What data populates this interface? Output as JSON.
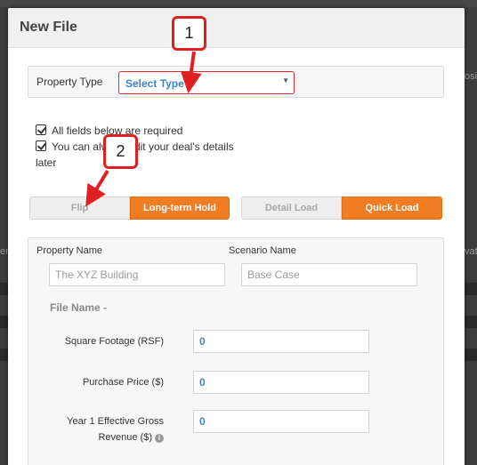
{
  "background": {
    "edge_text_right_1": "osit",
    "edge_text_left": "er",
    "edge_text_right_2": "vat"
  },
  "modal": {
    "title": "New File",
    "property_type": {
      "label": "Property Type",
      "selected": "Select Type"
    },
    "notes": [
      "All fields below are required",
      "You can always edit your deal's details",
      "later"
    ],
    "strategy_toggle": {
      "options": [
        "Flip",
        "Long-term Hold"
      ],
      "active": "Long-term Hold"
    },
    "load_toggle": {
      "options": [
        "Detail Load",
        "Quick Load"
      ],
      "active": "Quick Load"
    },
    "form": {
      "property_name_label": "Property Name",
      "property_name_placeholder": "The XYZ Building",
      "scenario_name_label": "Scenario Name",
      "scenario_name_placeholder": "Base Case",
      "file_name": "File Name -",
      "fields": [
        {
          "label": "Square Footage (RSF)",
          "value": "0"
        },
        {
          "label": "Purchase Price ($)",
          "value": "0"
        },
        {
          "label_line1": "Year 1 Effective Gross",
          "label_line2": "Revenue ($)",
          "value": "0"
        }
      ]
    }
  },
  "callouts": [
    "1",
    "2"
  ],
  "colors": {
    "accent_orange": "#f07c24",
    "select_text_blue": "#3a87c8",
    "callout_red": "#e02020"
  },
  "icons": [
    "check-square-icon",
    "chevron-down-icon",
    "info-circle-icon",
    "red-arrow"
  ]
}
